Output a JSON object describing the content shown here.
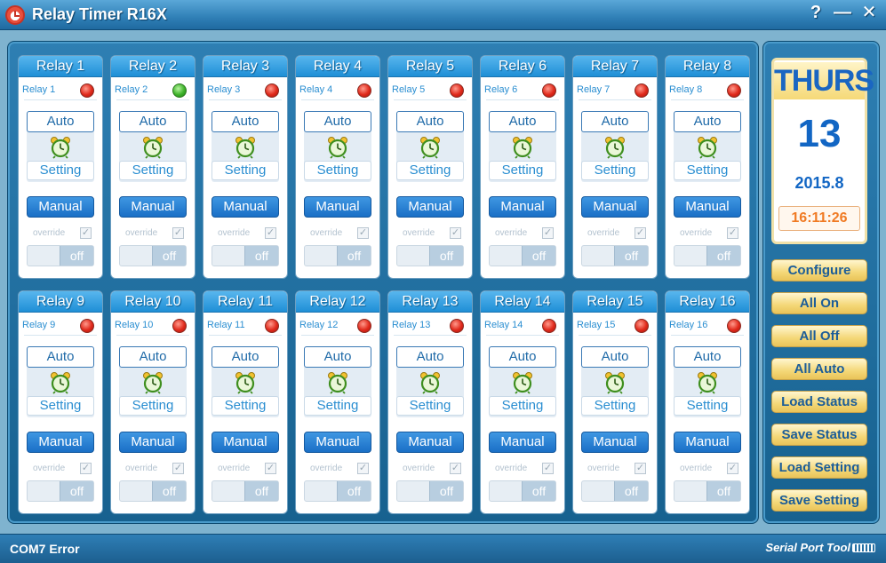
{
  "window": {
    "title": "Relay Timer R16X",
    "controls": {
      "help": "?",
      "minimize": "—",
      "close": "✕"
    }
  },
  "relay_labels": {
    "auto": "Auto",
    "setting": "Setting",
    "manual": "Manual",
    "override": "override",
    "override_checked": "✓",
    "toggle_state": "off"
  },
  "relays": [
    {
      "title": "Relay 1",
      "sub_label": "Relay 1",
      "status": "off"
    },
    {
      "title": "Relay 2",
      "sub_label": "Relay 2",
      "status": "on"
    },
    {
      "title": "Relay 3",
      "sub_label": "Relay 3",
      "status": "off"
    },
    {
      "title": "Relay 4",
      "sub_label": "Relay 4",
      "status": "off"
    },
    {
      "title": "Relay 5",
      "sub_label": "Relay 5",
      "status": "off"
    },
    {
      "title": "Relay 6",
      "sub_label": "Relay 6",
      "status": "off"
    },
    {
      "title": "Relay 7",
      "sub_label": "Relay 7",
      "status": "off"
    },
    {
      "title": "Relay 8",
      "sub_label": "Relay 8",
      "status": "off"
    },
    {
      "title": "Relay 9",
      "sub_label": "Relay 9",
      "status": "off"
    },
    {
      "title": "Relay 10",
      "sub_label": "Relay 10",
      "status": "off"
    },
    {
      "title": "Relay 11",
      "sub_label": "Relay 11",
      "status": "off"
    },
    {
      "title": "Relay 12",
      "sub_label": "Relay 12",
      "status": "off"
    },
    {
      "title": "Relay 13",
      "sub_label": "Relay 13",
      "status": "off"
    },
    {
      "title": "Relay 14",
      "sub_label": "Relay 14",
      "status": "off"
    },
    {
      "title": "Relay 15",
      "sub_label": "Relay 15",
      "status": "off"
    },
    {
      "title": "Relay 16",
      "sub_label": "Relay 16",
      "status": "off"
    }
  ],
  "calendar": {
    "day": "THURS",
    "date": "13",
    "year_month": "2015.8",
    "time": "16:11:26"
  },
  "side_buttons": [
    "Configure",
    "All On",
    "All Off",
    "All Auto",
    "Load Status",
    "Save Status",
    "Load Setting",
    "Save Setting"
  ],
  "status_bar": {
    "message": "COM7 Error",
    "brand": "Serial Port Tool"
  },
  "colors": {
    "accent": "#1f8fd6",
    "led_off": "#e0291b",
    "led_on": "#3db22a",
    "button_gold": "#f4d777"
  }
}
